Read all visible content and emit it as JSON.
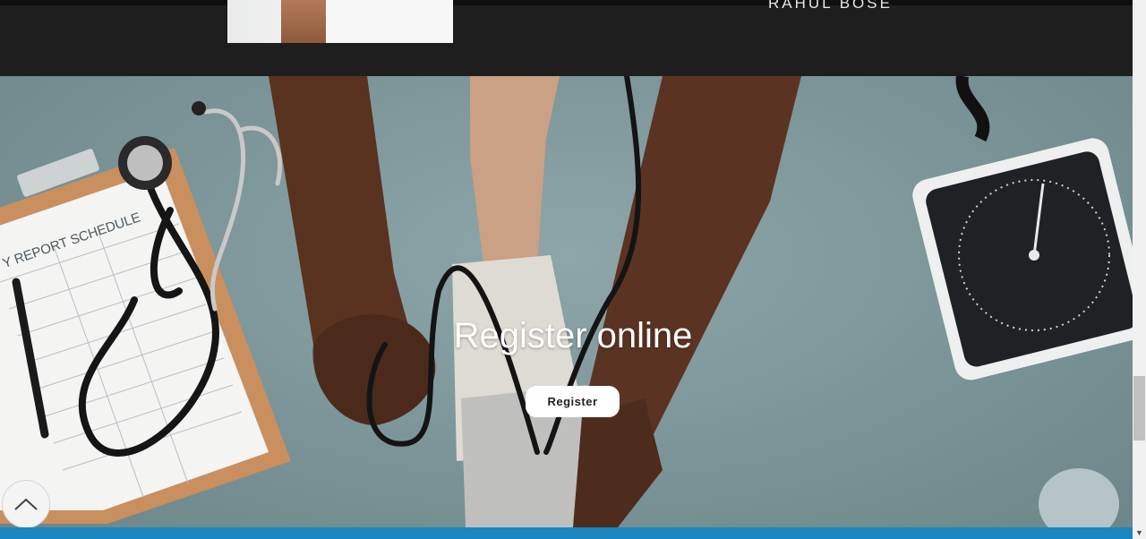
{
  "team": {
    "member_name": "RAHUL BOSE"
  },
  "hero": {
    "title": "Register online",
    "button_label": "Register",
    "clipboard_text": "Y REPORT SCHEDULE"
  },
  "icons": {
    "back_to_top": "chevron-up-icon",
    "scroll_down": "scroll-down-arrow-icon"
  },
  "colors": {
    "top_band": "#1e1e1e",
    "hero_bg": "#7b9497",
    "button_bg": "#ffffff",
    "bottom_bar": "#1b86bf"
  }
}
